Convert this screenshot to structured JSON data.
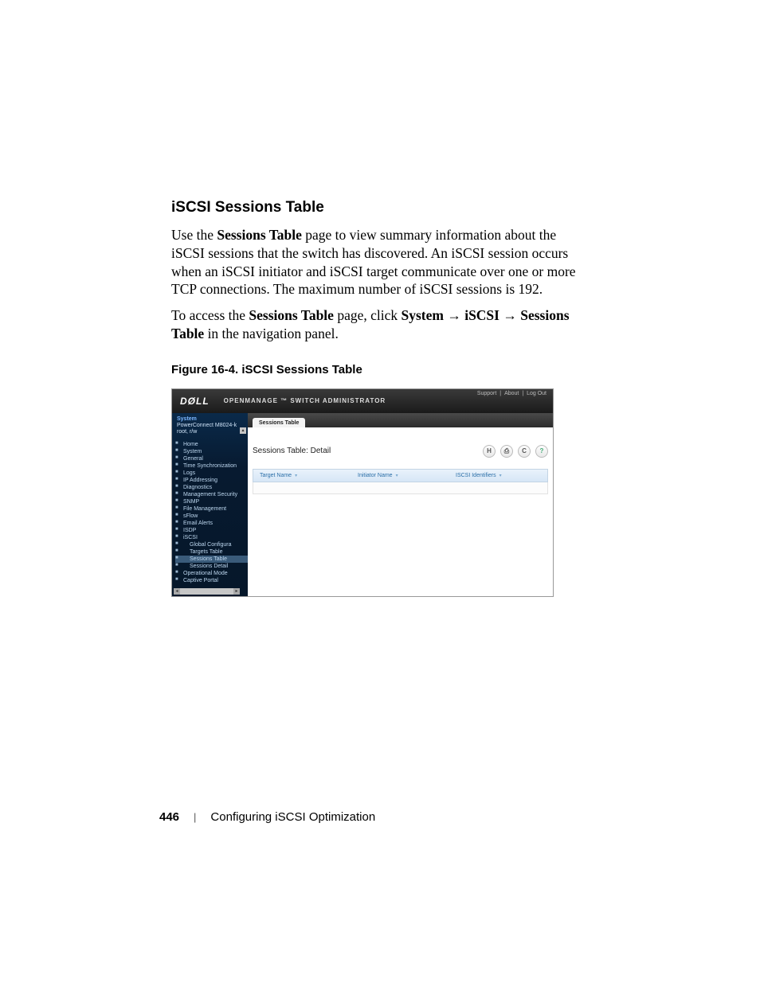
{
  "section_heading": "iSCSI Sessions Table",
  "para1_a": "Use the ",
  "para1_b": "Sessions Table",
  "para1_c": " page to view summary information about the iSCSI sessions that the switch has discovered. An iSCSI session occurs when an iSCSI initiator and iSCSI target communicate over one or more TCP connections. The maximum number of iSCSI sessions is 192.",
  "para2_a": "To access the ",
  "para2_b": "Sessions Table",
  "para2_c": " page, click ",
  "para2_d": "System",
  "para2_e": " → ",
  "para2_f": "iSCSI",
  "para2_g": " → ",
  "para2_h": "Sessions Table",
  "para2_i": " in the navigation panel.",
  "figure_caption": "Figure 16-4.    iSCSI Sessions Table",
  "screenshot": {
    "brand_logo_text": "DØLL",
    "app_name": "OPENMANAGE ™ SWITCH ADMINISTRATOR",
    "header_links": {
      "support": "Support",
      "about": "About",
      "logout": "Log Out"
    },
    "sidebar": {
      "system_label": "System",
      "device_model": "PowerConnect M8024-k",
      "user_line": "root, r/w",
      "items": [
        "Home",
        "System",
        "General",
        "Time Synchronization",
        "Logs",
        "IP Addressing",
        "Diagnostics",
        "Management Security",
        "SNMP",
        "File Management",
        "sFlow",
        "Email Alerts",
        "ISDP",
        "iSCSI",
        "Global Configura",
        "Targets Table",
        "Sessions Table",
        "Sessions Detail",
        "Operational Mode",
        "Captive Portal"
      ]
    },
    "main": {
      "tab_label": "Sessions Table",
      "page_title": "Sessions Table: Detail",
      "toolbar": {
        "save": "H",
        "print": "⎙",
        "refresh": "C",
        "help": "?"
      },
      "columns": {
        "c1": "Target Name",
        "c2": "Initiator Name",
        "c3": "ISCSI Identifiers"
      }
    }
  },
  "footer": {
    "page_number": "446",
    "bar": "|",
    "chapter": "Configuring iSCSI Optimization"
  }
}
